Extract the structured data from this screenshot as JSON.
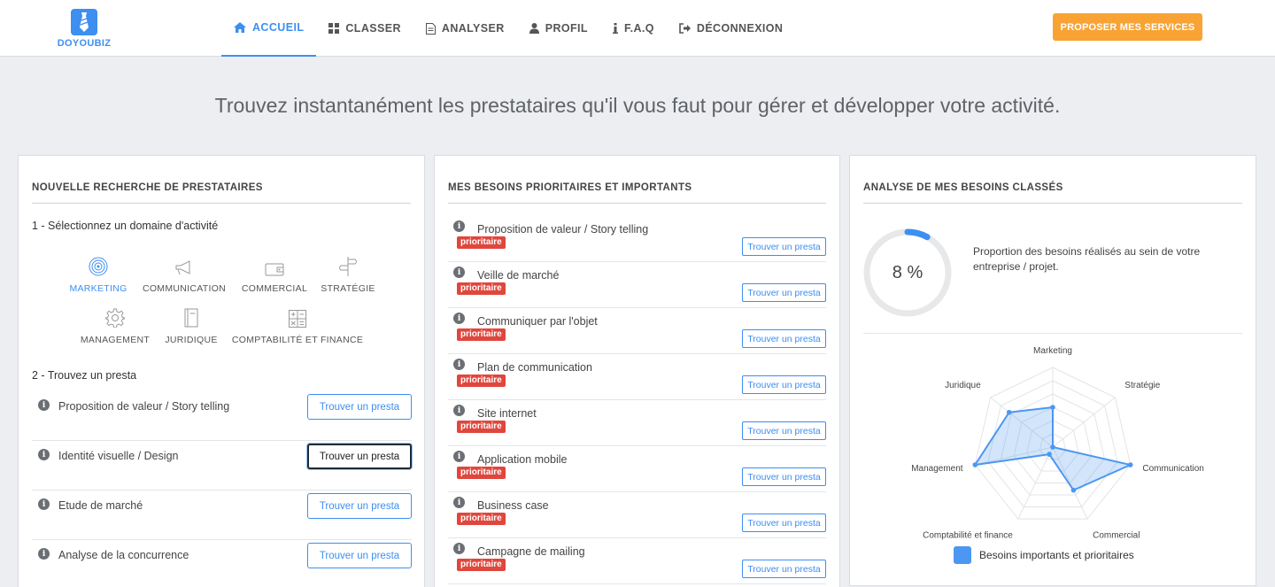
{
  "brand": {
    "name": "DOYOUBIZ",
    "color": "#3d8ff0"
  },
  "nav": {
    "items": [
      {
        "label": "ACCUEIL",
        "icon": "home-icon",
        "active": true
      },
      {
        "label": "CLASSER",
        "icon": "grid-icon"
      },
      {
        "label": "ANALYSER",
        "icon": "document-icon"
      },
      {
        "label": "PROFIL",
        "icon": "user-icon"
      },
      {
        "label": "F.A.Q",
        "icon": "info-icon"
      },
      {
        "label": "DÉCONNEXION",
        "icon": "logout-icon"
      }
    ],
    "cta": "PROPOSER MES SERVICES",
    "cta_color": "#f8a333"
  },
  "hero": {
    "title": "Trouvez instantanément les prestataires qu'il vous faut pour gérer et développer votre activité."
  },
  "search_panel": {
    "title": "NOUVELLE RECHERCHE DE PRESTATAIRES",
    "step1": "1 - Sélectionnez un domaine d'activité",
    "domains": [
      {
        "label": "MARKETING",
        "icon": "target-icon",
        "active": true
      },
      {
        "label": "COMMUNICATION",
        "icon": "megaphone-icon"
      },
      {
        "label": "COMMERCIAL",
        "icon": "wallet-icon"
      },
      {
        "label": "STRATÉGIE",
        "icon": "signpost-icon"
      },
      {
        "label": "MANAGEMENT",
        "icon": "gear-icon"
      },
      {
        "label": "JURIDIQUE",
        "icon": "book-icon"
      },
      {
        "label": "COMPTABILITÉ ET FINANCE",
        "icon": "calculator-icon"
      }
    ],
    "step2": "2 - Trouvez un presta",
    "button_label": "Trouver un presta",
    "items": [
      "Proposition de valeur / Story telling",
      "Identité visuelle / Design",
      "Etude de marché",
      "Analyse de la concurrence"
    ]
  },
  "priorities_panel": {
    "title": "MES BESOINS PRIORITAIRES ET IMPORTANTS",
    "badge": "prioritaire",
    "button_label": "Trouver un presta",
    "items": [
      "Proposition de valeur / Story telling",
      "Veille de marché",
      "Communiquer par l'objet",
      "Plan de communication",
      "Site internet",
      "Application mobile",
      "Business case",
      "Campagne de mailing"
    ]
  },
  "analysis_panel": {
    "title": "ANALYSE DE MES BESOINS CLASSÉS",
    "percent": 8,
    "percent_label": "8 %",
    "proportion_text": "Proportion des besoins réalisés au sein de votre entreprise / projet.",
    "legend": "Besoins importants et prioritaires"
  },
  "chart_data": {
    "type": "radar",
    "categories": [
      "Marketing",
      "Stratégie",
      "Communication",
      "Commercial",
      "Comptabilité et finance",
      "Management",
      "Juridique"
    ],
    "series": [
      {
        "name": "Besoins importants et prioritaires",
        "values": [
          0.5,
          0.0,
          1.0,
          0.6,
          0.1,
          1.0,
          0.7
        ]
      }
    ],
    "rings": 6,
    "color": "#4c97f1"
  }
}
